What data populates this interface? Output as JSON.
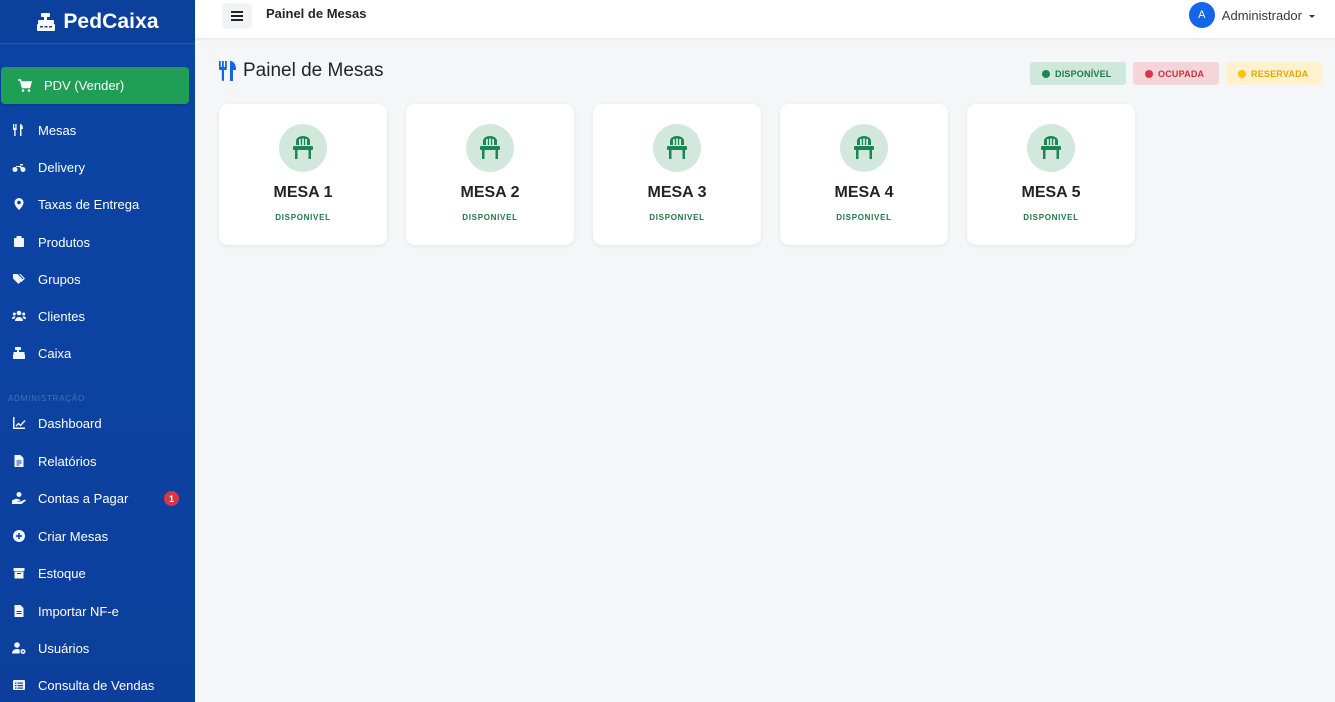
{
  "brand": {
    "name": "PedCaixa",
    "icon": "cash-register-icon"
  },
  "sidebar": {
    "pdv_label": "PDV (Vender)",
    "items": [
      {
        "label": "Mesas",
        "icon": "utensils-icon"
      },
      {
        "label": "Delivery",
        "icon": "motorcycle-icon"
      },
      {
        "label": "Taxas de Entrega",
        "icon": "map-pin-icon"
      },
      {
        "label": "Produtos",
        "icon": "box-icon"
      },
      {
        "label": "Grupos",
        "icon": "tags-icon"
      },
      {
        "label": "Clientes",
        "icon": "users-icon"
      },
      {
        "label": "Caixa",
        "icon": "cash-register-icon"
      }
    ],
    "section_label": "ADMINISTRAÇÃO",
    "admin_items": [
      {
        "label": "Dashboard",
        "icon": "chart-line-icon"
      },
      {
        "label": "Relatórios",
        "icon": "file-report-icon"
      },
      {
        "label": "Contas a Pagar",
        "icon": "hand-holding-dollar-icon",
        "badge": "1"
      },
      {
        "label": "Criar Mesas",
        "icon": "plus-circle-icon"
      },
      {
        "label": "Estoque",
        "icon": "warehouse-icon"
      },
      {
        "label": "Importar NF-e",
        "icon": "file-import-icon"
      },
      {
        "label": "Usuários",
        "icon": "user-gear-icon"
      },
      {
        "label": "Consulta de Vendas",
        "icon": "list-alt-icon"
      }
    ]
  },
  "topbar": {
    "title": "Painel de Mesas",
    "user_initial": "A",
    "user_name": "Administrador"
  },
  "main": {
    "title": "Painel de Mesas",
    "legend": [
      {
        "label": "DISPONÍVEL",
        "color": "#198754"
      },
      {
        "label": "OCUPADA",
        "color": "#dc3545"
      },
      {
        "label": "RESERVADA",
        "color": "#ffc107"
      }
    ],
    "tables": [
      {
        "name": "MESA 1",
        "status": "DISPONIVEL"
      },
      {
        "name": "MESA 2",
        "status": "DISPONIVEL"
      },
      {
        "name": "MESA 3",
        "status": "DISPONIVEL"
      },
      {
        "name": "MESA 4",
        "status": "DISPONIVEL"
      },
      {
        "name": "MESA 5",
        "status": "DISPONIVEL"
      }
    ]
  },
  "colors": {
    "sidebar": "#0c45a6",
    "accent_green": "#198754",
    "primary": "#1565e8"
  }
}
